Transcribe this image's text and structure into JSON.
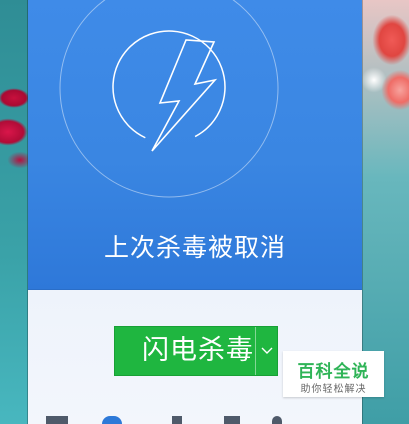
{
  "status": {
    "text": "上次杀毒被取消"
  },
  "scan_button": {
    "label": "闪电杀毒"
  },
  "watermark": {
    "title": "百科全说",
    "subtitle": "助你轻松解决"
  },
  "colors": {
    "hero_blue": "#3a86e2",
    "button_green": "#1fb640",
    "watermark_green": "#2fb457"
  },
  "icons": {
    "hero": "lightning-bolt-icon",
    "dropdown": "chevron-down-icon"
  }
}
